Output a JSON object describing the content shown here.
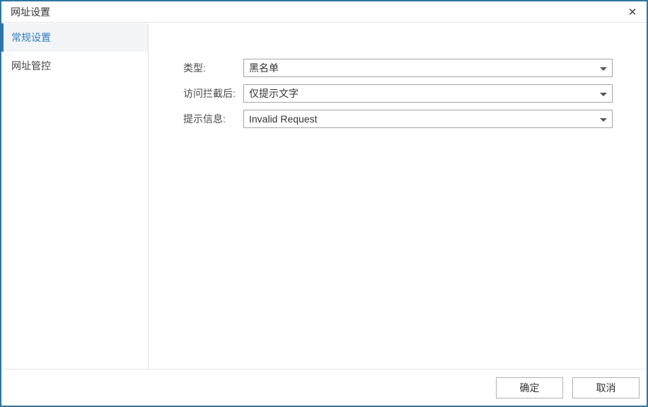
{
  "window": {
    "title": "网址设置",
    "close_glyph": "✕"
  },
  "sidebar": {
    "items": [
      {
        "label": "常规设置",
        "selected": true
      },
      {
        "label": "网址管控",
        "selected": false
      }
    ]
  },
  "form": {
    "fields": [
      {
        "label": "类型:",
        "value": "黑名单"
      },
      {
        "label": "访问拦截后:",
        "value": "仅提示文字"
      },
      {
        "label": "提示信息:",
        "value": "Invalid Request"
      }
    ]
  },
  "footer": {
    "ok_label": "确定",
    "cancel_label": "取消"
  },
  "colors": {
    "window_border": "#30749f",
    "accent_bar": "#2878c4",
    "selected_text": "#2e7fc1",
    "field_border": "#a6a6a6",
    "divider": "#e4e4e4"
  }
}
